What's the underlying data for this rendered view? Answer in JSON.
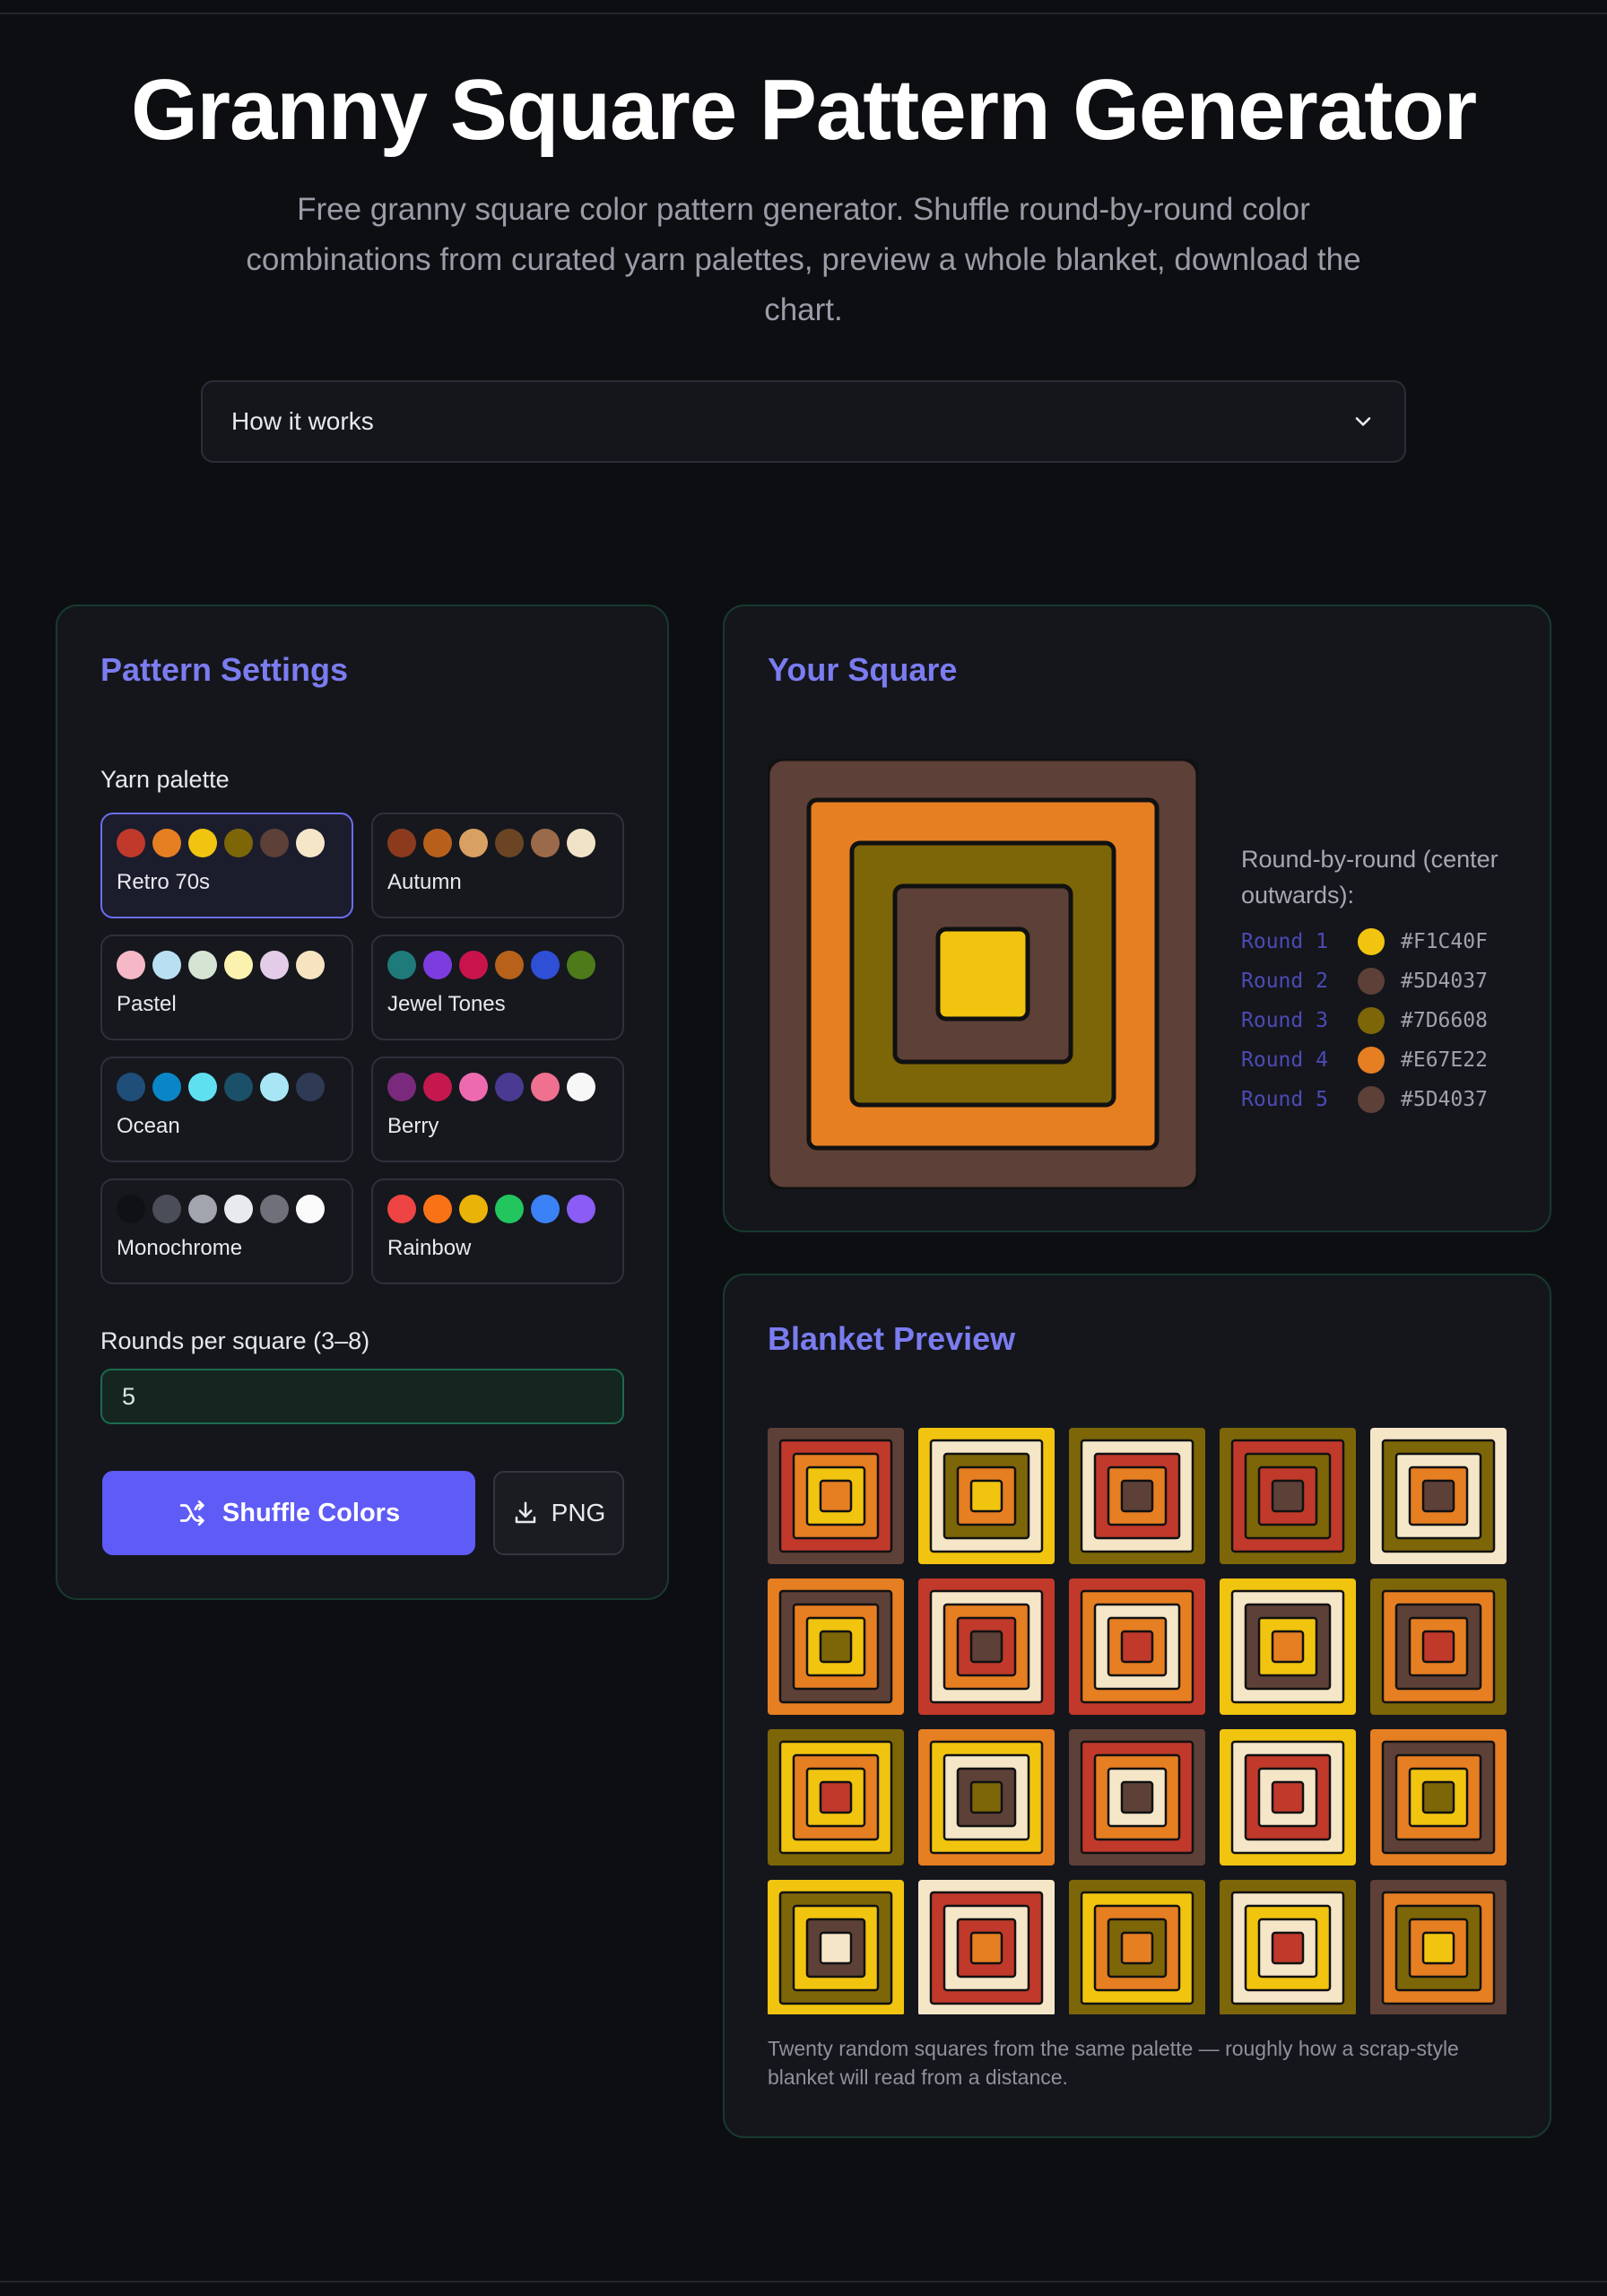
{
  "header": {
    "title": "Granny Square Pattern Generator",
    "subtitle": "Free granny square color pattern generator. Shuffle round-by-round color combinations from curated yarn palettes, preview a whole blanket, download the chart.",
    "how_it_works": "How it works"
  },
  "settings": {
    "heading": "Pattern Settings",
    "palette_label": "Yarn palette",
    "palettes": [
      {
        "name": "Retro 70s",
        "colors": [
          "#C0392B",
          "#E67E22",
          "#F1C40F",
          "#7D6608",
          "#5D4037",
          "#F5E6C8"
        ],
        "active": true
      },
      {
        "name": "Autumn",
        "colors": [
          "#8B3A1E",
          "#B8601B",
          "#D9A063",
          "#6B4523",
          "#9B6A4A",
          "#F1E3C8"
        ],
        "active": false
      },
      {
        "name": "Pastel",
        "colors": [
          "#F6B8C6",
          "#B9DFF3",
          "#D6E5D3",
          "#FCF2B0",
          "#E3CCE8",
          "#F7E3C0"
        ],
        "active": false
      },
      {
        "name": "Jewel Tones",
        "colors": [
          "#1F7A7A",
          "#7D3CE0",
          "#C8144A",
          "#B8611A",
          "#2E4FD6",
          "#4E7A1A"
        ],
        "active": false
      },
      {
        "name": "Ocean",
        "colors": [
          "#1F4E79",
          "#0A86C8",
          "#5FE0F0",
          "#1A5068",
          "#A8E6F5",
          "#2F3A55"
        ],
        "active": false
      },
      {
        "name": "Berry",
        "colors": [
          "#7A2A7C",
          "#C4184E",
          "#EE6AAF",
          "#4A3A92",
          "#F07090",
          "#F7F7F7"
        ],
        "active": false
      },
      {
        "name": "Monochrome",
        "colors": [
          "#0F1117",
          "#4B4E59",
          "#A2A5AE",
          "#E9EAEE",
          "#6F7079",
          "#FBFBFB"
        ],
        "active": false
      },
      {
        "name": "Rainbow",
        "colors": [
          "#EF4444",
          "#F97316",
          "#EAB308",
          "#22C55E",
          "#3B82F6",
          "#8B5CF6"
        ],
        "active": false
      }
    ],
    "rounds_label": "Rounds per square (3–8)",
    "rounds_value": "5",
    "shuffle_label": "Shuffle Colors",
    "png_label": "PNG",
    "shuffle_icon": "shuffle-icon",
    "download_icon": "download-icon"
  },
  "square": {
    "heading": "Your Square",
    "rbr_title": "Round-by-round (center outwards):",
    "rounds": [
      {
        "label": "Round 1",
        "hex": "#F1C40F"
      },
      {
        "label": "Round 2",
        "hex": "#5D4037"
      },
      {
        "label": "Round 3",
        "hex": "#7D6608"
      },
      {
        "label": "Round 4",
        "hex": "#E67E22"
      },
      {
        "label": "Round 5",
        "hex": "#5D4037"
      }
    ]
  },
  "blanket": {
    "heading": "Blanket Preview",
    "caption": "Twenty random squares from the same palette — roughly how a scrap-style blanket will read from a distance.",
    "squares": [
      [
        "#5D4037",
        "#C0392B",
        "#E67E22",
        "#F1C40F",
        "#E67E22"
      ],
      [
        "#F1C40F",
        "#F5E6C8",
        "#7D6608",
        "#E67E22",
        "#F1C40F"
      ],
      [
        "#7D6608",
        "#F5E6C8",
        "#C0392B",
        "#E67E22",
        "#5D4037"
      ],
      [
        "#7D6608",
        "#C0392B",
        "#7D6608",
        "#C0392B",
        "#5D4037"
      ],
      [
        "#F5E6C8",
        "#7D6608",
        "#F5E6C8",
        "#E67E22",
        "#5D4037"
      ],
      [
        "#E67E22",
        "#5D4037",
        "#E67E22",
        "#F1C40F",
        "#7D6608"
      ],
      [
        "#C0392B",
        "#F5E6C8",
        "#E67E22",
        "#C0392B",
        "#5D4037"
      ],
      [
        "#C0392B",
        "#E67E22",
        "#F5E6C8",
        "#E67E22",
        "#C0392B"
      ],
      [
        "#F1C40F",
        "#F5E6C8",
        "#5D4037",
        "#F1C40F",
        "#E67E22"
      ],
      [
        "#7D6608",
        "#E67E22",
        "#5D4037",
        "#E67E22",
        "#C0392B"
      ],
      [
        "#7D6608",
        "#F1C40F",
        "#E67E22",
        "#F1C40F",
        "#C0392B"
      ],
      [
        "#E67E22",
        "#F1C40F",
        "#F5E6C8",
        "#5D4037",
        "#7D6608"
      ],
      [
        "#5D4037",
        "#C0392B",
        "#E67E22",
        "#F5E6C8",
        "#5D4037"
      ],
      [
        "#F1C40F",
        "#F5E6C8",
        "#C0392B",
        "#F5E6C8",
        "#C0392B"
      ],
      [
        "#E67E22",
        "#5D4037",
        "#E67E22",
        "#F1C40F",
        "#7D6608"
      ],
      [
        "#F1C40F",
        "#7D6608",
        "#F1C40F",
        "#5D4037",
        "#F5E6C8"
      ],
      [
        "#F5E6C8",
        "#C0392B",
        "#F5E6C8",
        "#C0392B",
        "#E67E22"
      ],
      [
        "#7D6608",
        "#F1C40F",
        "#E67E22",
        "#7D6608",
        "#E67E22"
      ],
      [
        "#7D6608",
        "#F5E6C8",
        "#F1C40F",
        "#F5E6C8",
        "#C0392B"
      ],
      [
        "#5D4037",
        "#E67E22",
        "#7D6608",
        "#E67E22",
        "#F1C40F"
      ]
    ]
  }
}
